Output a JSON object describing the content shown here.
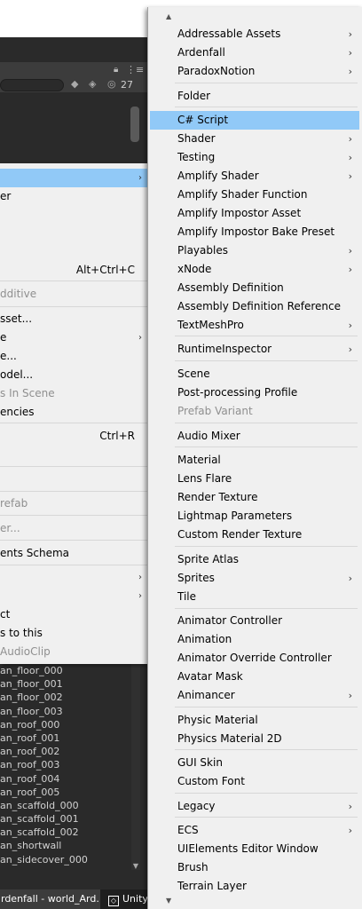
{
  "project_panel": {
    "hidden_count": "27",
    "assets": [
      "an_floor_000",
      "an_floor_001",
      "an_floor_002",
      "an_floor_003",
      "an_roof_000",
      "an_roof_001",
      "an_roof_002",
      "an_roof_003",
      "an_roof_004",
      "an_roof_005",
      "an_scaffold_000",
      "an_scaffold_001",
      "an_scaffold_002",
      "an_shortwall",
      "an_sidecover_000"
    ]
  },
  "taskbar": {
    "item1": "rdenfall - world_Ard...",
    "item2": "Unity"
  },
  "left_menu": {
    "items": [
      {
        "label": "er"
      },
      {
        "label": "",
        "shortcut": "Alt+Ctrl+C"
      },
      {
        "label": "dditive"
      },
      {
        "label": "sset..."
      },
      {
        "label": "e"
      },
      {
        "label": "e..."
      },
      {
        "label": "odel..."
      },
      {
        "label": "s In Scene"
      },
      {
        "label": "encies"
      },
      {
        "label": "",
        "shortcut": "Ctrl+R"
      },
      {
        "label": "refab"
      },
      {
        "label": "er..."
      },
      {
        "label": "ents Schema"
      },
      {
        "label": "ct"
      },
      {
        "label": "s to this"
      },
      {
        "label": "AudioClip"
      }
    ]
  },
  "create_menu": {
    "items": [
      "Addressable Assets",
      "Ardenfall",
      "ParadoxNotion",
      "Folder",
      "C# Script",
      "Shader",
      "Testing",
      "Amplify Shader",
      "Amplify Shader Function",
      "Amplify Impostor Asset",
      "Amplify Impostor Bake Preset",
      "Playables",
      "xNode",
      "Assembly Definition",
      "Assembly Definition Reference",
      "TextMeshPro",
      "RuntimeInspector",
      "Scene",
      "Post-processing Profile",
      "Prefab Variant",
      "Audio Mixer",
      "Material",
      "Lens Flare",
      "Render Texture",
      "Lightmap Parameters",
      "Custom Render Texture",
      "Sprite Atlas",
      "Sprites",
      "Tile",
      "Animator Controller",
      "Animation",
      "Animator Override Controller",
      "Avatar Mask",
      "Animancer",
      "Physic Material",
      "Physics Material 2D",
      "GUI Skin",
      "Custom Font",
      "Legacy",
      "ECS",
      "UIElements Editor Window",
      "Brush",
      "Terrain Layer"
    ]
  },
  "colors": {
    "menu_bg": "#f0f0f0",
    "highlight": "#91c9f7",
    "disabled_text": "#8f8f8f",
    "editor_dark": "#2a2a2a"
  }
}
